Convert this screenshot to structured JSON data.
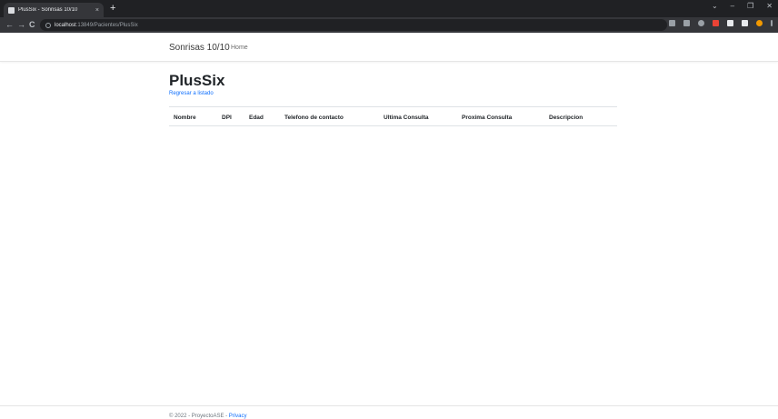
{
  "browser": {
    "tab_title": "PlusSix - Sonrisas 10/10",
    "tab_close": "×",
    "new_tab": "+",
    "url_host": "localhost",
    "url_rest": ":13849/Pacientes/PlusSix",
    "back": "←",
    "forward": "→",
    "reload": "C",
    "window_controls": [
      "⌄",
      "–",
      "❐",
      "✕"
    ],
    "extension_colors": [
      "#9aa0a6",
      "#9aa0a6",
      "#9aa0a6",
      "#ea4335",
      "#e8eaed",
      "#e8eaed",
      "#f29900",
      "#9aa0a6"
    ]
  },
  "navbar": {
    "brand": "Sonrisas 10/10",
    "home": "Home"
  },
  "page": {
    "title": "PlusSix",
    "back_link": "Regresar a listado"
  },
  "table": {
    "headers": [
      "Nombre",
      "DPI",
      "Edad",
      "Telefono de contacto",
      "Ultima Consulta",
      "Proxima Consulta",
      "Descripcion"
    ]
  },
  "footer": {
    "text": "© 2022 - ProyectoASE - ",
    "privacy": "Privacy"
  }
}
